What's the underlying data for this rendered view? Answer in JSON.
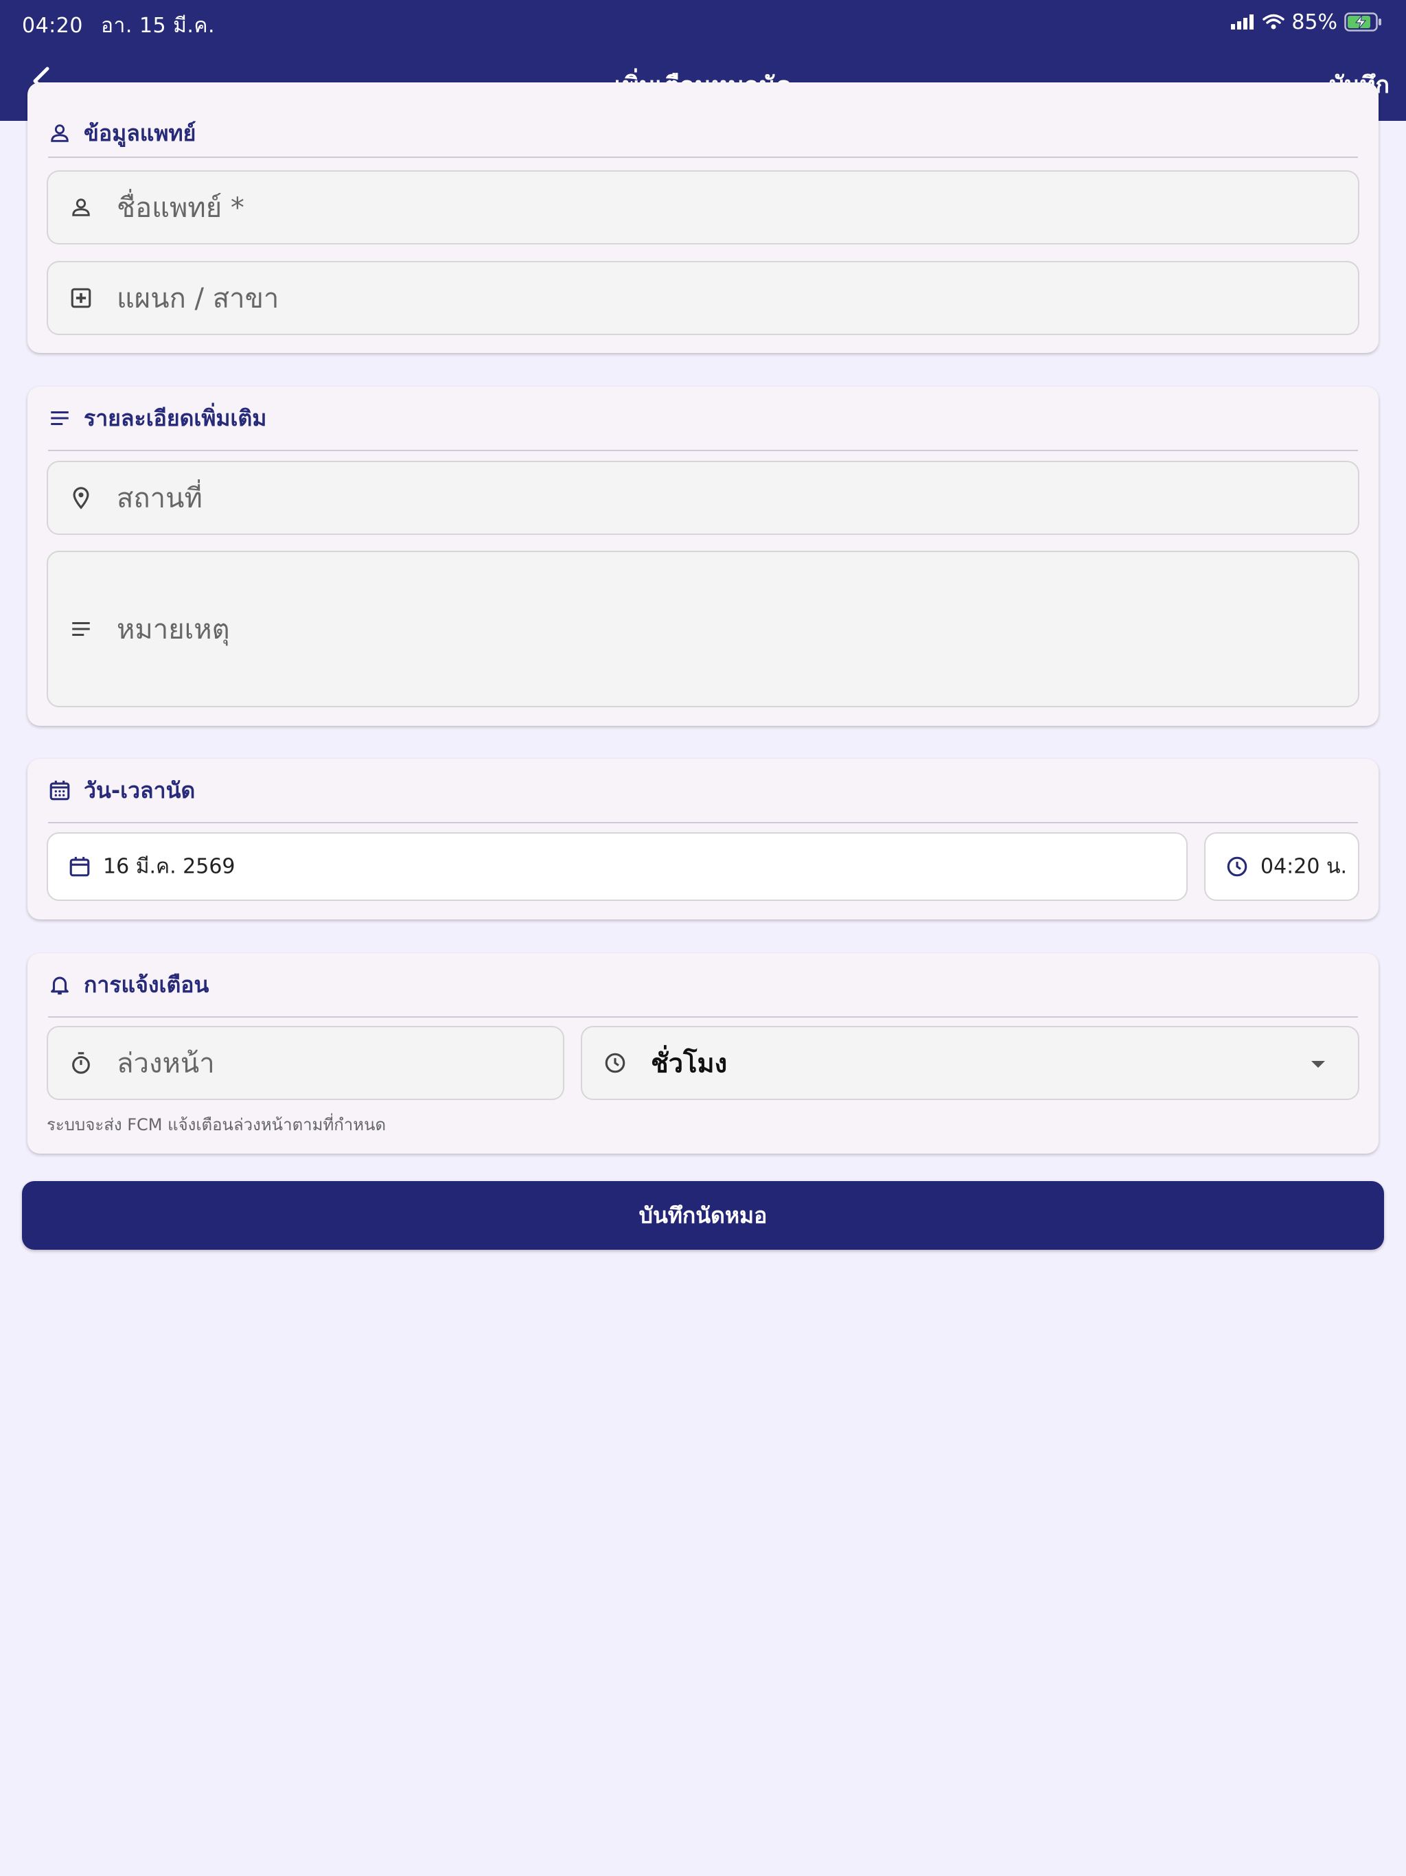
{
  "status_bar": {
    "time": "04:20",
    "date": "อา. 15 มี.ค.",
    "battery": "85%"
  },
  "nav": {
    "title": "เพิ่มเตือนหมอนัด",
    "action": "บันทึก"
  },
  "doctor_section": {
    "title": "ข้อมูลแพทย์",
    "name_placeholder": "ชื่อแพทย์ *",
    "department_placeholder": "แผนก / สาขา"
  },
  "details_section": {
    "title": "รายละเอียดเพิ่มเติม",
    "location_placeholder": "สถานที่",
    "note_placeholder": "หมายเหตุ"
  },
  "datetime_section": {
    "title": "วัน-เวลานัด",
    "date_value": "16 มี.ค. 2569",
    "time_value": "04:20 น."
  },
  "reminder_section": {
    "title": "การแจ้งเตือน",
    "advance_placeholder": "ล่วงหน้า",
    "unit_value": "ชั่วโมง",
    "helper": "ระบบจะส่ง FCM แจ้งเตือนล่วงหน้าตามที่กำหนด"
  },
  "submit_label": "บันทึกนัดหมอ",
  "colors": {
    "primary": "#262a78",
    "background": "#f3f0fd",
    "card": "#f7f3f9"
  }
}
